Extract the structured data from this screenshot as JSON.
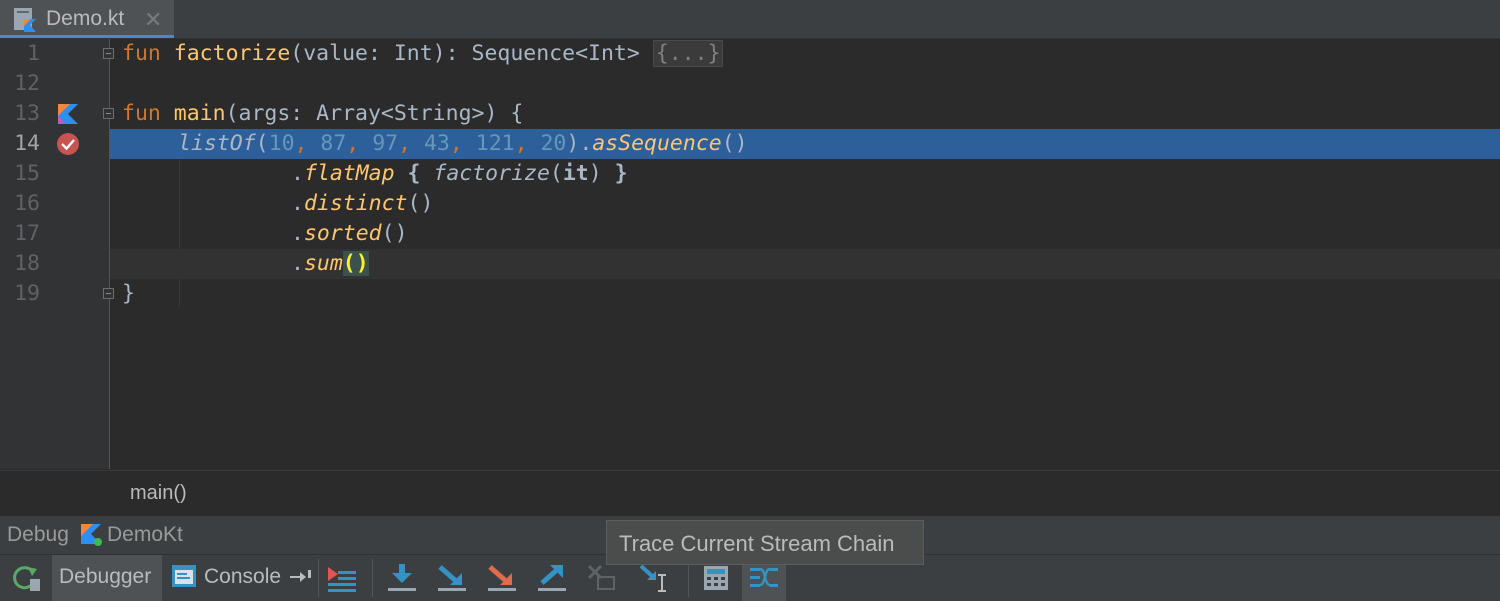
{
  "tab": {
    "filename": "Demo.kt",
    "close_glyph": "✕"
  },
  "editor": {
    "lines": [
      {
        "num": "1",
        "tokens": {
          "kw": "fun",
          "name": "factorize",
          "sig": "(value: Int): Sequence<Int>",
          "fold": "{...}"
        }
      },
      {
        "num": "12"
      },
      {
        "num": "13",
        "tokens": {
          "kw": "fun",
          "name": "main",
          "sig": "(args: Array<String>) {"
        }
      },
      {
        "num": "14",
        "tokens": {
          "call": "listOf",
          "open": "(",
          "n1": "10",
          "n2": "87",
          "n3": "97",
          "n4": "43",
          "n5": "121",
          "n6": "20",
          "close": ").",
          "call2": "asSequence",
          "tail": "()"
        }
      },
      {
        "num": "15",
        "tokens": {
          "dot": ".",
          "call": "flatMap",
          "brace1": " { ",
          "call2": "factorize",
          "p1": "(",
          "it": "it",
          "p2": ") ",
          "brace2": "}"
        }
      },
      {
        "num": "16",
        "tokens": {
          "dot": ".",
          "call": "distinct",
          "tail": "()"
        }
      },
      {
        "num": "17",
        "tokens": {
          "dot": ".",
          "call": "sorted",
          "tail": "()"
        }
      },
      {
        "num": "18",
        "tokens": {
          "dot": ".",
          "call": "sum",
          "tail": "()"
        }
      },
      {
        "num": "19",
        "tokens": {
          "close": "}"
        }
      }
    ]
  },
  "breadcrumb": {
    "label": "main()"
  },
  "debug": {
    "title": "Debug",
    "config": "DemoKt"
  },
  "toolbar": {
    "debugger_label": "Debugger",
    "console_label": "Console"
  },
  "tooltip": {
    "text": "Trace Current Stream Chain"
  },
  "colors": {
    "selection": "#2d5f9a",
    "accent": "#4a88c7",
    "keyword": "#cc7832",
    "function": "#ffc66d",
    "number": "#6897bb"
  }
}
